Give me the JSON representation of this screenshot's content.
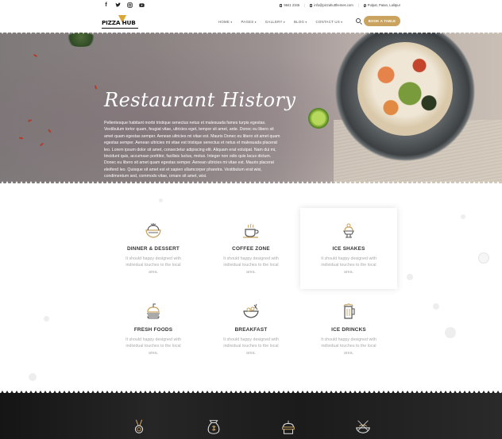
{
  "topbar": {
    "social_icons": [
      "facebook-icon",
      "twitter-icon",
      "instagram-icon",
      "youtube-icon"
    ],
    "phone": "9841 2345",
    "email": "info@pizzahutthemes.com",
    "address": "Pulpat, Patan, Lalitpur"
  },
  "header": {
    "logo_text": "PIZZA HUB",
    "nav": [
      "HOME",
      "PAGES",
      "GALLERY",
      "BLOG",
      "CONTACT US"
    ],
    "book_button": "BOOK A TABLE",
    "accent": "#c9a35f"
  },
  "hero": {
    "title": "Restaurant History",
    "text": "Pellentesque habitant morbi tristique senectus netus et malesuada fames turpis egestas. Vestibulum tortor quam, feugiat vitae, ultricies eget, tempor sit amet, ante. Donec eu libero sit amet quam egestas semper. Aenean ultricies mi vitae est. Mauris Donec eu libero sit amet quam egestas semper. Aenean ultricies mi vitae est tristique senectus et netus et malesuada placerat leo. Lorem ipsum dolor sit amet, consectetur adipiscing elit. Aliquam erat volutpat. Nam dui mi, tincidunt quis, accumsan porttitor, facilisis luctus, metus. Integer non odio quis lacus dictum. Donec eu libero sit amet quam egestas semper. Aenean ultricies mi vitae est. Mauris placerat eleifend leo. Quisque sit amet est et sapien ullamcorper pharetra. Vestibulum erat wisi, condimentum sed, commodo vitae, ornare sit amet, wisi."
  },
  "features": [
    {
      "title": "DINNER & DESSERT",
      "desc": "It should happy designed with individual touches to the local area.",
      "icon": "dessert-bowl-icon"
    },
    {
      "title": "COFFEE ZONE",
      "desc": "It should happy designed with individual touches to the local area.",
      "icon": "coffee-cup-icon"
    },
    {
      "title": "ICE SHAKES",
      "desc": "It should happy designed with individual touches to the local area.",
      "icon": "ice-cream-icon"
    },
    {
      "title": "FRESH FOODS",
      "desc": "It should happy designed with individual touches to the local area.",
      "icon": "burger-icon"
    },
    {
      "title": "BREAKFAST",
      "desc": "It should happy designed with individual touches to the local area.",
      "icon": "breakfast-bowl-icon"
    },
    {
      "title": "ICE DRINCKS",
      "desc": "It should happy designed with individual touches to the local area.",
      "icon": "beer-mug-icon"
    }
  ],
  "bottom_icons": [
    "medal-icon",
    "money-bag-icon",
    "cake-icon",
    "dish-icon"
  ]
}
